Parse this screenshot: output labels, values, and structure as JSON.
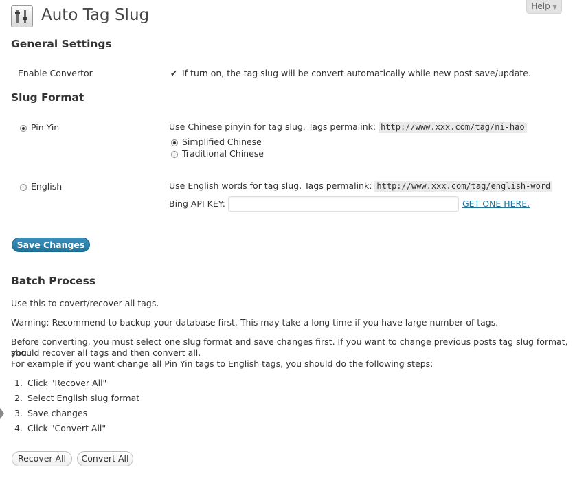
{
  "header": {
    "title": "Auto Tag Slug",
    "help_label": "Help",
    "help_arrow": "▼"
  },
  "general": {
    "heading": "General Settings",
    "enable_label": "Enable Convertor",
    "enable_checked": true,
    "enable_description": "If turn on, the tag slug will be convert automatically while new post save/update."
  },
  "slug_format": {
    "heading": "Slug Format",
    "pinyin": {
      "label": "Pin Yin",
      "selected": true,
      "description": "Use Chinese pinyin for tag slug. Tags permalink:",
      "example": "http://www.xxx.com/tag/ni-hao",
      "options": [
        {
          "label": "Simplified Chinese",
          "selected": true
        },
        {
          "label": "Traditional Chinese",
          "selected": false
        }
      ]
    },
    "english": {
      "label": "English",
      "selected": false,
      "description": "Use English words for tag slug. Tags permalink:",
      "example": "http://www.xxx.com/tag/english-word",
      "api_label": "Bing API KEY:",
      "api_value": "",
      "api_link": "GET ONE HERE."
    }
  },
  "save_button": "Save Changes",
  "batch": {
    "heading": "Batch Process",
    "intro": "Use this to covert/recover all tags.",
    "warning": "Warning: Recommend to backup your database first. This may take a long time if you have large number of tags.",
    "before_line1": "Before converting, you must select one slug format and save changes first. If you want to change previous posts tag slug format, you",
    "before_line2": "should recover all tags and then convert all.",
    "example_line": "For example if you want change all Pin Yin tags to English tags, you should do the following steps:",
    "steps": [
      {
        "num": "1.",
        "text": "Click \"Recover All\""
      },
      {
        "num": "2.",
        "text": "Select English slug format"
      },
      {
        "num": "3.",
        "text": "Save changes"
      },
      {
        "num": "4.",
        "text": "Click \"Convert All\""
      }
    ],
    "recover_button": "Recover All",
    "convert_button": "Convert All"
  }
}
